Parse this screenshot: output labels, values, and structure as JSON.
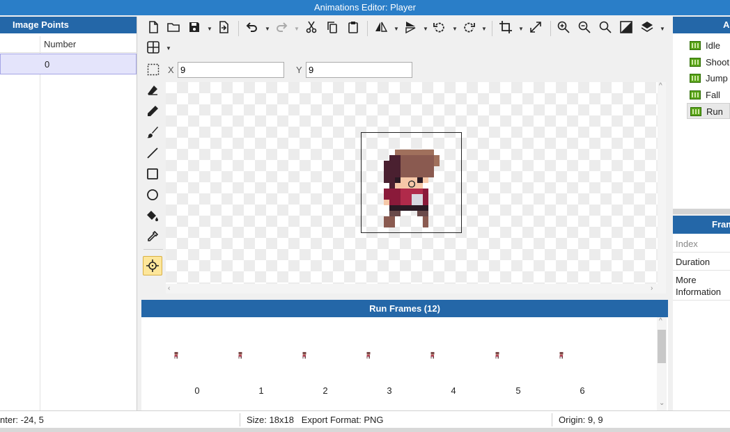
{
  "window": {
    "title": "Animations Editor: Player"
  },
  "image_points": {
    "title": "Image Points",
    "column": "Number",
    "rows": [
      "0"
    ]
  },
  "toolbar": {
    "icons": [
      "new-file-icon",
      "open-folder-icon",
      "save-icon",
      "export-icon",
      "undo-icon",
      "redo-icon",
      "cut-icon",
      "copy-icon",
      "paste-icon",
      "flip-horizontal-icon",
      "flip-vertical-icon",
      "rotate-left-icon",
      "rotate-right-icon",
      "crop-icon",
      "resize-icon",
      "zoom-in-icon",
      "zoom-out-icon",
      "zoom-fit-icon",
      "toggle-background-icon",
      "layers-icon",
      "grid-icon"
    ]
  },
  "coords": {
    "x_label": "X",
    "x_value": "9",
    "y_label": "Y",
    "y_value": "9"
  },
  "tools": [
    "eraser-icon",
    "pencil-icon",
    "brush-icon",
    "line-icon",
    "rectangle-icon",
    "ellipse-icon",
    "fill-icon",
    "eyedropper-icon",
    "origin-point-icon"
  ],
  "frames": {
    "title": "Run Frames (12)",
    "items": [
      {
        "label": "0"
      },
      {
        "label": "1"
      },
      {
        "label": "2"
      },
      {
        "label": "3"
      },
      {
        "label": "4"
      },
      {
        "label": "5"
      },
      {
        "label": "6"
      }
    ]
  },
  "animations": {
    "title": "A",
    "items": [
      "Idle",
      "Shoot",
      "Jump",
      "Fall",
      "Run"
    ],
    "selected": "Run"
  },
  "frame_props": {
    "title": "Fram",
    "rows": [
      "Index",
      "Duration",
      "More Information"
    ]
  },
  "status": {
    "left": "nter: -24, 5",
    "middle": "Size: 18x18   Export Format: PNG",
    "right": "Origin: 9, 9"
  },
  "colors": {
    "accent": "#2467a8",
    "titlebar": "#2a7ec8",
    "selection": "#e4e4fb"
  }
}
